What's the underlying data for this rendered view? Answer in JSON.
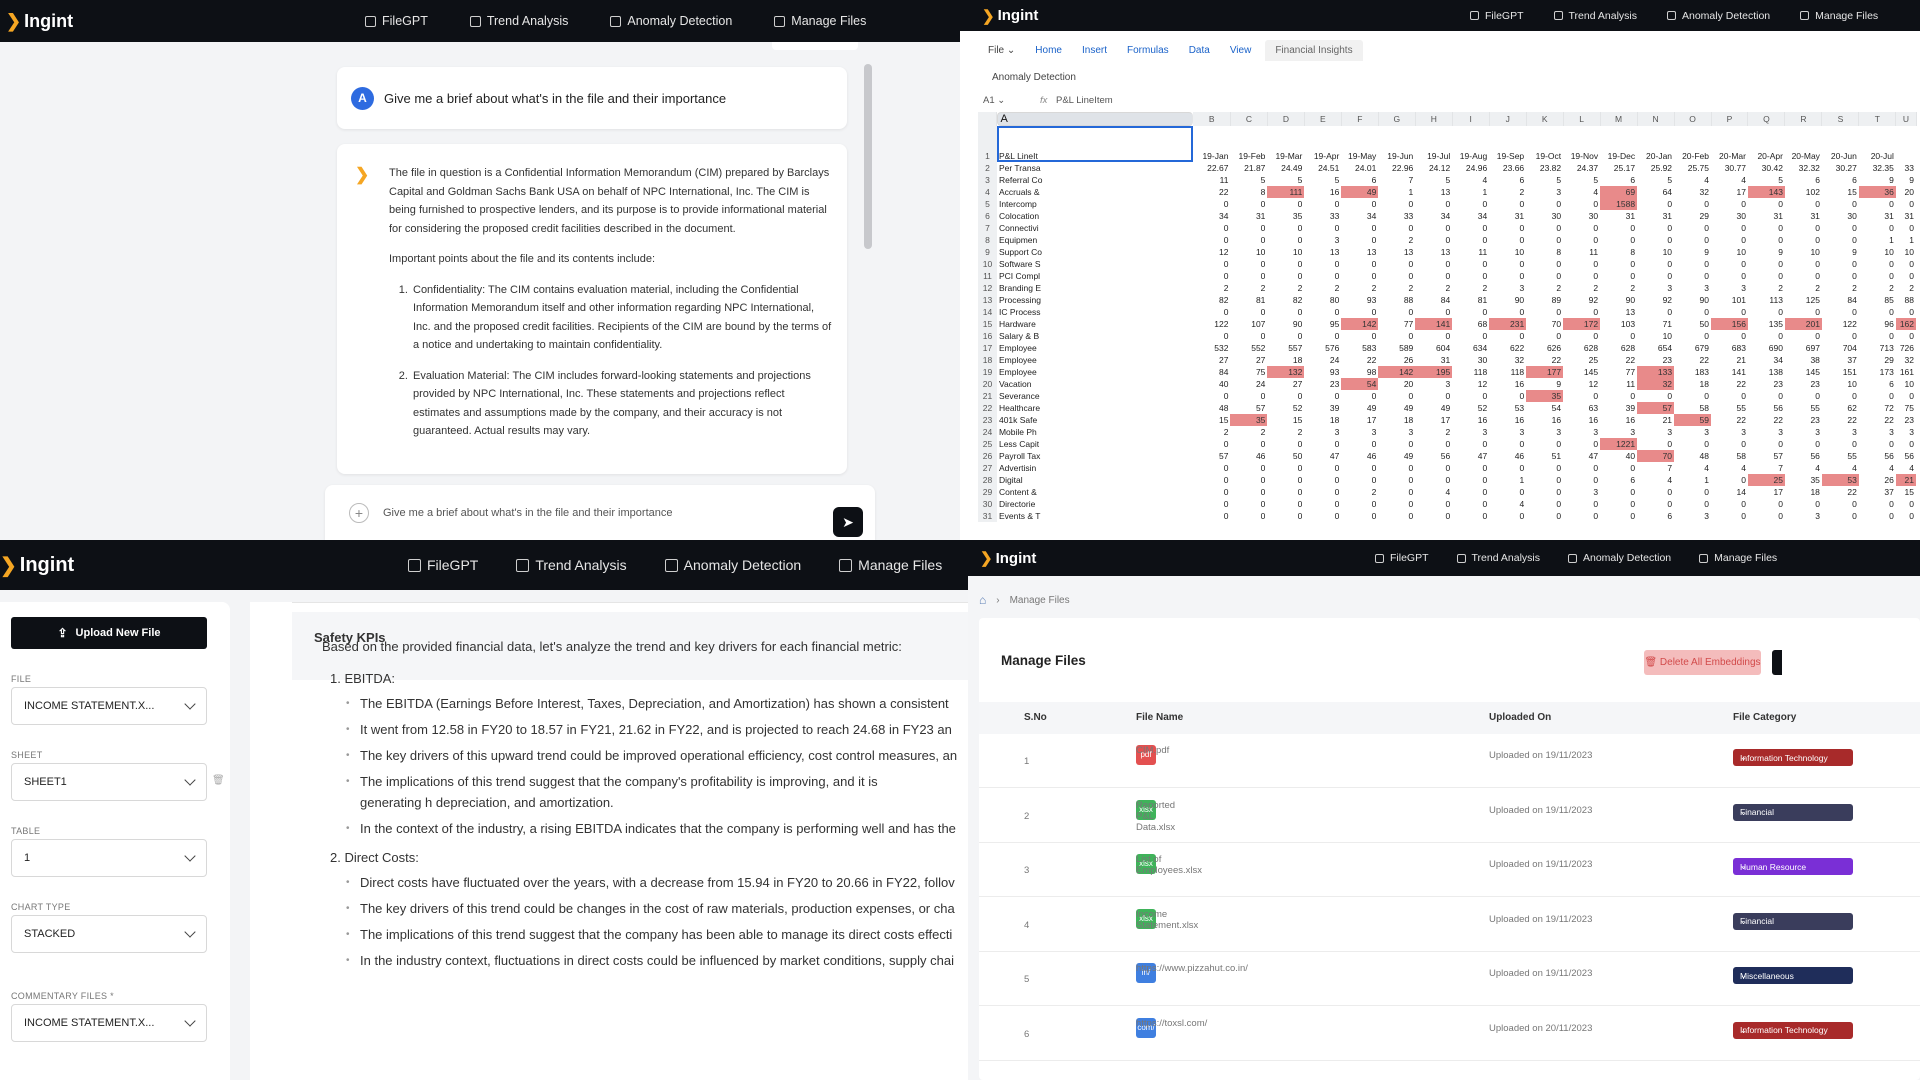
{
  "brand": "Ingint",
  "nav": [
    "FileGPT",
    "Trend Analysis",
    "Anomaly Detection",
    "Manage Files"
  ],
  "chat": {
    "avatar": "A",
    "question": "Give me a brief about what's in the file and their importance",
    "answer_p1": "The file in question is a Confidential Information Memorandum (CIM) prepared by Barclays Capital and Goldman Sachs Bank USA on behalf of NPC International, Inc. The CIM is being furnished to prospective lenders, and its purpose is to provide informational material for considering the proposed credit facilities described in the document.",
    "answer_p2": "Important points about the file and its contents include:",
    "answer_item1": "Confidentiality: The CIM contains evaluation material, including the Confidential Information Memorandum itself and other information regarding NPC International, Inc. and the proposed credit facilities. Recipients of the CIM are bound by the terms of a notice and undertaking to maintain confidentiality.",
    "answer_item2": "Evaluation Material: The CIM includes forward-looking statements and projections provided by NPC International, Inc. These statements and projections reflect estimates and assumptions made by the company, and their accuracy is not guaranteed. Actual results may vary.",
    "input_value": "Give me a brief about what's in the file and their importance"
  },
  "sheet": {
    "ribbon_tabs": [
      "File",
      "Home",
      "Insert",
      "Formulas",
      "Data",
      "View",
      "Financial Insights"
    ],
    "title": "Anomaly Detection",
    "cell_ref": "A1",
    "fx": "fx",
    "formula_value": "P&L LineItem",
    "columns": [
      "A",
      "B",
      "C",
      "D",
      "E",
      "F",
      "G",
      "H",
      "I",
      "J",
      "K",
      "L",
      "M",
      "N",
      "O",
      "P",
      "Q",
      "R",
      "S",
      "T",
      "U"
    ],
    "headers": [
      "P&L LineIt",
      "19-Jan",
      "19-Feb",
      "19-Mar",
      "19-Apr",
      "19-May",
      "19-Jun",
      "19-Jul",
      "19-Aug",
      "19-Sep",
      "19-Oct",
      "19-Nov",
      "19-Dec",
      "20-Jan",
      "20-Feb",
      "20-Mar",
      "20-Apr",
      "20-May",
      "20-Jun",
      "20-Jul",
      ""
    ],
    "rows": [
      {
        "n": "2",
        "label": "Per Transa",
        "values": [
          "22.67",
          "21.87",
          "24.49",
          "24.51",
          "24.01",
          "22.96",
          "24.12",
          "24.96",
          "23.66",
          "23.82",
          "24.37",
          "25.17",
          "25.92",
          "25.75",
          "30.77",
          "30.42",
          "32.32",
          "30.27",
          "32.35",
          "33"
        ],
        "hl": []
      },
      {
        "n": "3",
        "label": "Referral Co",
        "values": [
          "11",
          "5",
          "5",
          "5",
          "6",
          "7",
          "5",
          "4",
          "6",
          "5",
          "5",
          "6",
          "5",
          "4",
          "4",
          "5",
          "6",
          "6",
          "9",
          "9"
        ],
        "hl": []
      },
      {
        "n": "4",
        "label": "Accruals &",
        "values": [
          "22",
          "8",
          "111",
          "16",
          "49",
          "1",
          "13",
          "1",
          "2",
          "3",
          "4",
          "69",
          "64",
          "32",
          "17",
          "143",
          "102",
          "15",
          "36",
          "20"
        ],
        "hl": [
          2,
          4,
          11,
          15,
          18
        ]
      },
      {
        "n": "5",
        "label": "Intercomp",
        "values": [
          "0",
          "0",
          "0",
          "0",
          "0",
          "0",
          "0",
          "0",
          "0",
          "0",
          "0",
          "1588",
          "0",
          "0",
          "0",
          "0",
          "0",
          "0",
          "0",
          "0"
        ],
        "hl": [
          11
        ]
      },
      {
        "n": "6",
        "label": "Colocation",
        "values": [
          "34",
          "31",
          "35",
          "33",
          "34",
          "33",
          "34",
          "34",
          "31",
          "30",
          "30",
          "31",
          "31",
          "29",
          "30",
          "31",
          "31",
          "30",
          "31",
          "31"
        ],
        "hl": []
      },
      {
        "n": "7",
        "label": "Connectivi",
        "values": [
          "0",
          "0",
          "0",
          "0",
          "0",
          "0",
          "0",
          "0",
          "0",
          "0",
          "0",
          "0",
          "0",
          "0",
          "0",
          "0",
          "0",
          "0",
          "0",
          "0"
        ],
        "hl": []
      },
      {
        "n": "8",
        "label": "Equipmen",
        "values": [
          "0",
          "0",
          "0",
          "3",
          "0",
          "2",
          "0",
          "0",
          "0",
          "0",
          "0",
          "0",
          "0",
          "0",
          "0",
          "0",
          "0",
          "0",
          "1",
          "1"
        ],
        "hl": []
      },
      {
        "n": "9",
        "label": "Support Co",
        "values": [
          "12",
          "10",
          "10",
          "13",
          "13",
          "13",
          "13",
          "11",
          "10",
          "8",
          "11",
          "8",
          "10",
          "9",
          "10",
          "9",
          "10",
          "9",
          "10",
          "10"
        ],
        "hl": []
      },
      {
        "n": "10",
        "label": "Software S",
        "values": [
          "0",
          "0",
          "0",
          "0",
          "0",
          "0",
          "0",
          "0",
          "0",
          "0",
          "0",
          "0",
          "0",
          "0",
          "0",
          "0",
          "0",
          "0",
          "0",
          "0"
        ],
        "hl": []
      },
      {
        "n": "11",
        "label": "PCI Compl",
        "values": [
          "0",
          "0",
          "0",
          "0",
          "0",
          "0",
          "0",
          "0",
          "0",
          "0",
          "0",
          "0",
          "0",
          "0",
          "0",
          "0",
          "0",
          "0",
          "0",
          "0"
        ],
        "hl": []
      },
      {
        "n": "12",
        "label": "Branding E",
        "values": [
          "2",
          "2",
          "2",
          "2",
          "2",
          "2",
          "2",
          "2",
          "3",
          "2",
          "2",
          "2",
          "3",
          "3",
          "3",
          "2",
          "2",
          "2",
          "2",
          "2"
        ],
        "hl": []
      },
      {
        "n": "13",
        "label": "Processing",
        "values": [
          "82",
          "81",
          "82",
          "80",
          "93",
          "88",
          "84",
          "81",
          "90",
          "89",
          "92",
          "90",
          "92",
          "90",
          "101",
          "113",
          "125",
          "84",
          "85",
          "88"
        ],
        "hl": []
      },
      {
        "n": "14",
        "label": "IC Process",
        "values": [
          "0",
          "0",
          "0",
          "0",
          "0",
          "0",
          "0",
          "0",
          "0",
          "0",
          "0",
          "13",
          "0",
          "0",
          "0",
          "0",
          "0",
          "0",
          "0",
          "0"
        ],
        "hl": []
      },
      {
        "n": "15",
        "label": "Hardware",
        "values": [
          "122",
          "107",
          "90",
          "95",
          "142",
          "77",
          "141",
          "68",
          "231",
          "70",
          "172",
          "103",
          "71",
          "50",
          "156",
          "135",
          "201",
          "122",
          "96",
          "162"
        ],
        "hl": [
          4,
          6,
          8,
          10,
          14,
          16,
          19
        ]
      },
      {
        "n": "16",
        "label": "Salary & B",
        "values": [
          "0",
          "0",
          "0",
          "0",
          "0",
          "0",
          "0",
          "0",
          "0",
          "0",
          "0",
          "0",
          "10",
          "0",
          "0",
          "0",
          "0",
          "0",
          "0",
          "0"
        ],
        "hl": []
      },
      {
        "n": "17",
        "label": "Employee",
        "values": [
          "532",
          "552",
          "557",
          "576",
          "583",
          "589",
          "604",
          "634",
          "622",
          "626",
          "628",
          "628",
          "654",
          "679",
          "683",
          "690",
          "697",
          "704",
          "713",
          "726"
        ],
        "hl": []
      },
      {
        "n": "18",
        "label": "Employee",
        "values": [
          "27",
          "27",
          "18",
          "24",
          "22",
          "26",
          "31",
          "30",
          "32",
          "22",
          "25",
          "22",
          "23",
          "22",
          "21",
          "34",
          "38",
          "37",
          "29",
          "32"
        ],
        "hl": []
      },
      {
        "n": "19",
        "label": "Employee",
        "values": [
          "84",
          "75",
          "132",
          "93",
          "98",
          "142",
          "195",
          "118",
          "118",
          "177",
          "145",
          "77",
          "133",
          "183",
          "141",
          "138",
          "145",
          "151",
          "173",
          "161"
        ],
        "hl": [
          2,
          5,
          6,
          9,
          12
        ]
      },
      {
        "n": "20",
        "label": "Vacation",
        "values": [
          "40",
          "24",
          "27",
          "23",
          "54",
          "20",
          "3",
          "12",
          "16",
          "9",
          "12",
          "11",
          "32",
          "18",
          "22",
          "23",
          "23",
          "10",
          "6",
          "10"
        ],
        "hl": [
          4,
          12
        ]
      },
      {
        "n": "21",
        "label": "Severance",
        "values": [
          "0",
          "0",
          "0",
          "0",
          "0",
          "0",
          "0",
          "0",
          "0",
          "35",
          "0",
          "0",
          "0",
          "0",
          "0",
          "0",
          "0",
          "0",
          "0",
          "0"
        ],
        "hl": [
          9
        ]
      },
      {
        "n": "22",
        "label": "Healthcare",
        "values": [
          "48",
          "57",
          "52",
          "39",
          "49",
          "49",
          "49",
          "52",
          "53",
          "54",
          "63",
          "39",
          "57",
          "58",
          "55",
          "56",
          "55",
          "62",
          "72",
          "75"
        ],
        "hl": [
          12
        ]
      },
      {
        "n": "23",
        "label": "401k Safe",
        "values": [
          "15",
          "35",
          "15",
          "18",
          "17",
          "18",
          "17",
          "16",
          "16",
          "16",
          "16",
          "16",
          "21",
          "59",
          "22",
          "22",
          "23",
          "22",
          "22",
          "23"
        ],
        "hl": [
          1,
          13
        ]
      },
      {
        "n": "24",
        "label": "Mobile Ph",
        "values": [
          "2",
          "2",
          "2",
          "3",
          "3",
          "3",
          "2",
          "3",
          "3",
          "3",
          "3",
          "3",
          "3",
          "3",
          "3",
          "3",
          "3",
          "3",
          "3",
          "3"
        ],
        "hl": []
      },
      {
        "n": "25",
        "label": "Less Capit",
        "values": [
          "0",
          "0",
          "0",
          "0",
          "0",
          "0",
          "0",
          "0",
          "0",
          "0",
          "0",
          "1221",
          "0",
          "0",
          "0",
          "0",
          "0",
          "0",
          "0",
          "0"
        ],
        "hl": [
          11
        ]
      },
      {
        "n": "26",
        "label": "Payroll Tax",
        "values": [
          "57",
          "46",
          "50",
          "47",
          "46",
          "49",
          "56",
          "47",
          "46",
          "51",
          "47",
          "40",
          "70",
          "48",
          "58",
          "57",
          "56",
          "55",
          "56",
          "56"
        ],
        "hl": [
          12
        ]
      },
      {
        "n": "27",
        "label": "Advertisin",
        "values": [
          "0",
          "0",
          "0",
          "0",
          "0",
          "0",
          "0",
          "0",
          "0",
          "0",
          "0",
          "0",
          "7",
          "4",
          "4",
          "7",
          "4",
          "4",
          "4",
          "4"
        ],
        "hl": []
      },
      {
        "n": "28",
        "label": "Digital",
        "values": [
          "0",
          "0",
          "0",
          "0",
          "0",
          "0",
          "0",
          "0",
          "1",
          "0",
          "0",
          "6",
          "4",
          "1",
          "0",
          "25",
          "35",
          "53",
          "26",
          "21"
        ],
        "hl": [
          15,
          17,
          19
        ]
      },
      {
        "n": "29",
        "label": "Content &",
        "values": [
          "0",
          "0",
          "0",
          "0",
          "2",
          "0",
          "4",
          "0",
          "0",
          "0",
          "3",
          "0",
          "0",
          "0",
          "14",
          "17",
          "18",
          "22",
          "37",
          "15"
        ],
        "hl": []
      },
      {
        "n": "30",
        "label": "Directorie",
        "values": [
          "0",
          "0",
          "0",
          "0",
          "0",
          "0",
          "0",
          "0",
          "4",
          "0",
          "0",
          "0",
          "0",
          "0",
          "0",
          "0",
          "0",
          "0",
          "0",
          "0"
        ],
        "hl": []
      },
      {
        "n": "31",
        "label": "Events & T",
        "values": [
          "0",
          "0",
          "0",
          "0",
          "0",
          "0",
          "0",
          "0",
          "0",
          "0",
          "0",
          "0",
          "6",
          "3",
          "0",
          "0",
          "3",
          "0",
          "0",
          "0"
        ],
        "hl": []
      }
    ]
  },
  "trend": {
    "upload_label": "Upload New File",
    "file_label": "FILE",
    "file_value": "INCOME STATEMENT.X...",
    "sheet_label": "SHEET",
    "sheet_value": "SHEET1",
    "table_label": "TABLE",
    "table_value": "1",
    "chart_type_label": "CHART TYPE",
    "chart_type_value": "STACKED",
    "commentary_label": "COMMENTARY FILES *",
    "commentary_value": "INCOME STATEMENT.X...",
    "kpi_title": "Safety KPIs",
    "lead": "Based on the provided financial data, let's analyze the trend and key drivers for each financial metric:",
    "h1": "1.  EBITDA:",
    "b1": "The EBITDA (Earnings Before Interest, Taxes, Depreciation, and Amortization) has shown a consistent",
    "b2": "It went from 12.58 in FY20 to 18.57 in FY21, 21.62 in FY22, and is projected to reach 24.68 in FY23 an",
    "b3": "The key drivers of this upward trend could be improved operational efficiency, cost control measures, an",
    "b4": "The implications of this trend suggest that the company's profitability is improving, and it is generating h depreciation, and amortization.",
    "b5": "In the context of the industry, a rising EBITDA indicates that the company is performing well and has the",
    "h2": "2.  Direct Costs:",
    "b6": "Direct costs have fluctuated over the years, with a decrease from 15.94 in FY20 to 20.66 in FY22, follov",
    "b7": "The key drivers of this trend could be changes in the cost of raw materials, production expenses, or cha",
    "b8": "The implications of this trend suggest that the company has been able to manage its direct costs effecti",
    "b9": "In the industry context, fluctuations in direct costs could be influenced by market conditions, supply chai"
  },
  "manage": {
    "breadcrumb": "Manage Files",
    "title": "Manage Files",
    "delete_label": "Delete All Embeddings",
    "col_sno": "S.No",
    "col_name": "File Name",
    "col_uploaded": "Uploaded On",
    "col_category": "File Category",
    "rows": [
      {
        "no": "1",
        "ext": "pdf",
        "name": "CIM.pdf",
        "uploaded": "Uploaded on 19/11/2023",
        "category": "Information Technology",
        "icon_color": "#e35050",
        "cat_color": "#a82a2a"
      },
      {
        "no": "2",
        "ext": "xlsx",
        "name": "Reported P&L Data.xlsx",
        "uploaded": "Uploaded on 19/11/2023",
        "category": "Financial",
        "icon_color": "#3fb35a",
        "cat_color": "#3a3d5c"
      },
      {
        "no": "3",
        "ext": "xlsx",
        "name": "List of Employees.xlsx",
        "uploaded": "Uploaded on 19/11/2023",
        "category": "Human Resource",
        "icon_color": "#3fb35a",
        "cat_color": "#7a2fd6"
      },
      {
        "no": "4",
        "ext": "xlsx",
        "name": "Income Statement.xlsx",
        "uploaded": "Uploaded on 19/11/2023",
        "category": "Financial",
        "icon_color": "#3fb35a",
        "cat_color": "#3a3d5c"
      },
      {
        "no": "5",
        "ext": "in/",
        "name": "https://www.pizzahut.co.in/",
        "uploaded": "Uploaded on 19/11/2023",
        "category": "Miscellaneous",
        "icon_color": "#3f7fe0",
        "cat_color": "#1f2d5a"
      },
      {
        "no": "6",
        "ext": "com/",
        "name": "https://toxsl.com/",
        "uploaded": "Uploaded on 20/11/2023",
        "category": "Information Technology",
        "icon_color": "#3f7fe0",
        "cat_color": "#a82a2a"
      }
    ]
  }
}
